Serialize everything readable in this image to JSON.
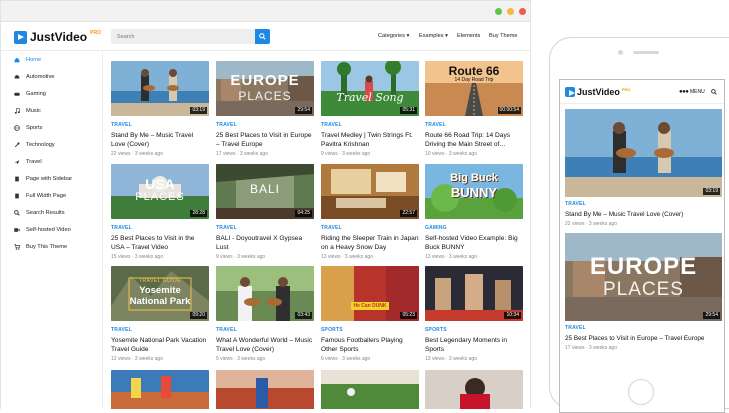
{
  "brand": {
    "name": "JustVideo",
    "badge": "PRO"
  },
  "search": {
    "placeholder": "Search"
  },
  "nav": {
    "categories": "Categories",
    "examples": "Examples",
    "elements": "Elements",
    "buy": "Buy Theme"
  },
  "sidebar": {
    "items": [
      {
        "label": "Home",
        "icon": "home-icon"
      },
      {
        "label": "Automotive",
        "icon": "car-icon"
      },
      {
        "label": "Gaming",
        "icon": "gamepad-icon"
      },
      {
        "label": "Music",
        "icon": "music-icon"
      },
      {
        "label": "Sports",
        "icon": "sports-icon"
      },
      {
        "label": "Technology",
        "icon": "wrench-icon"
      },
      {
        "label": "Travel",
        "icon": "plane-icon"
      },
      {
        "label": "Page with Sidebar",
        "icon": "page-icon"
      },
      {
        "label": "Full Width Page",
        "icon": "page-icon"
      },
      {
        "label": "Search Results",
        "icon": "search-icon"
      },
      {
        "label": "Self-hosted Video",
        "icon": "video-icon"
      },
      {
        "label": "Buy This Theme",
        "icon": "cart-icon"
      }
    ]
  },
  "videos": [
    {
      "cat": "TRAVEL",
      "title": "Stand By Me – Music Travel Love (Cover)",
      "views": "22 views",
      "age": "3 weeks ago",
      "dur": "03:19",
      "overlay": ""
    },
    {
      "cat": "TRAVEL",
      "title": "25 Best Places to Visit in Europe – Travel Europe",
      "views": "17 views",
      "age": "3 weeks ago",
      "dur": "29:54",
      "overlay": "EUROPE PLACES"
    },
    {
      "cat": "TRAVEL",
      "title": "Travel Medley | Twin Strings Ft. Pavitra Krishnan",
      "views": "9 views",
      "age": "3 weeks ago",
      "dur": "05:31",
      "overlay": "Travel Song"
    },
    {
      "cat": "TRAVEL",
      "title": "Route 66 Road Trip: 14 Days Driving the Main Street of…",
      "views": "10 views",
      "age": "3 weeks ago",
      "dur": "00:00:54",
      "overlay": "Route 66"
    },
    {
      "cat": "TRAVEL",
      "title": "25 Best Places to Visit in the USA – Travel Video",
      "views": "15 views",
      "age": "3 weeks ago",
      "dur": "28:28",
      "overlay": "USA PLACES"
    },
    {
      "cat": "TRAVEL",
      "title": "BALI - Doyoutravel X Gypsea Lust",
      "views": "9 views",
      "age": "3 weeks ago",
      "dur": "04:25",
      "overlay": "BALI"
    },
    {
      "cat": "TRAVEL",
      "title": "Riding the Sleeper Train in Japan on a Heavy Snow Day",
      "views": "13 views",
      "age": "3 weeks ago",
      "dur": "22:57",
      "overlay": ""
    },
    {
      "cat": "GAMING",
      "title": "Self-hosted Video Example: Big Buck BUNNY",
      "views": "13 views",
      "age": "3 weeks ago",
      "dur": "",
      "overlay": "Big Buck BUNNY"
    },
    {
      "cat": "TRAVEL",
      "title": "Yosemite National Park Vacation Travel Guide",
      "views": "12 views",
      "age": "3 weeks ago",
      "dur": "09:20",
      "overlay": "Yosemite National Park"
    },
    {
      "cat": "TRAVEL",
      "title": "What A Wonderful World – Music Travel Love (Cover)",
      "views": "5 views",
      "age": "3 weeks ago",
      "dur": "03:43",
      "overlay": ""
    },
    {
      "cat": "SPORTS",
      "title": "Famous Footballers Playing Other Sports",
      "views": "6 views",
      "age": "3 weeks ago",
      "dur": "05:23",
      "overlay": ""
    },
    {
      "cat": "SPORTS",
      "title": "Best Legendary Moments in Sports",
      "views": "13 views",
      "age": "3 weeks ago",
      "dur": "10:34",
      "overlay": ""
    }
  ],
  "phone": {
    "menu": "MENU",
    "cards": [
      {
        "cat": "TRAVEL",
        "title": "Stand By Me – Music Travel Love (Cover)",
        "views": "22 views",
        "age": "3 weeks ago",
        "dur": "03:19"
      },
      {
        "cat": "TRAVEL",
        "title": "25 Best Places to Visit in Europe – Travel Europe",
        "views": "17 views",
        "age": "3 weeks ago",
        "dur": "29:54"
      }
    ]
  },
  "colors": {
    "accent": "#1e88e5",
    "badge": "#f2a100"
  }
}
